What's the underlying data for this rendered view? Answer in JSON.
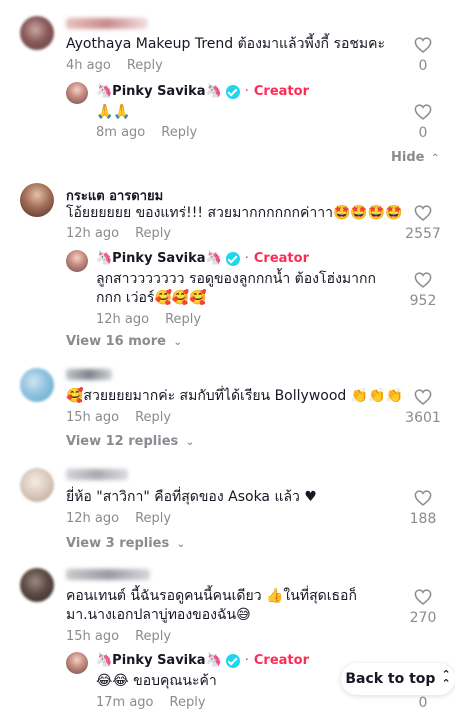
{
  "comments": [
    {
      "name": "",
      "text": "Ayothaya Makeup Trend ต้องมาแล้วพี้งกี้ รอชมคะ",
      "time": "4h ago",
      "reply_label": "Reply",
      "likes": "0",
      "replies": [
        {
          "name": "🦄Pinky Savika🦄",
          "badge": "Creator",
          "text": "🙏🙏",
          "time": "8m ago",
          "reply_label": "Reply",
          "likes": "0"
        }
      ],
      "hide_label": "Hide"
    },
    {
      "name": "กระแต อารดายม",
      "text": "โอ้ยยยยยย ของแทร่!!! สวยมากกกกกกค่าาา🤩🤩🤩🤩",
      "time": "12h ago",
      "reply_label": "Reply",
      "likes": "2557",
      "replies": [
        {
          "name": "🦄Pinky Savika🦄",
          "badge": "Creator",
          "text": "ลูกสาววววววว รอดูของลูกกกน้ำ ต้องโฮ่งมากกกกก เว่อร์🥰🥰🥰",
          "time": "12h ago",
          "reply_label": "Reply",
          "likes": "952"
        }
      ],
      "more_label": "View 16 more"
    },
    {
      "name": "",
      "text": "🥰สวยยยยมากค่ะ สมกับที่ได้เรียน Bollywood 👏👏👏",
      "time": "15h ago",
      "reply_label": "Reply",
      "likes": "3601",
      "more_label": "View 12 replies"
    },
    {
      "name": "",
      "text": "ยี่ห้อ \"สาวิกา\" คือที่สุดของ Asoka แล้ว ♥",
      "time": "12h ago",
      "reply_label": "Reply",
      "likes": "188",
      "more_label": "View 3 replies"
    },
    {
      "name": "",
      "text": "คอนเทนต์ นี้ฉันรอดูคนนี้คนเดียว 👍ในที่สุดเธอก็มา.นางเอกปลาบู่ทองของฉัน😅",
      "time": "15h ago",
      "reply_label": "Reply",
      "likes": "270",
      "replies": [
        {
          "name": "🦄Pinky Savika🦄",
          "badge": "Creator",
          "text": "😂😂 ขอบคุณนะค้า",
          "time": "17m ago",
          "reply_label": "Reply",
          "likes": "0"
        }
      ]
    }
  ],
  "back_to_top": "Back to top",
  "colors": {
    "creator": "#fe2c55",
    "verified": "#20d5ec",
    "muted": "#8a8b91"
  }
}
